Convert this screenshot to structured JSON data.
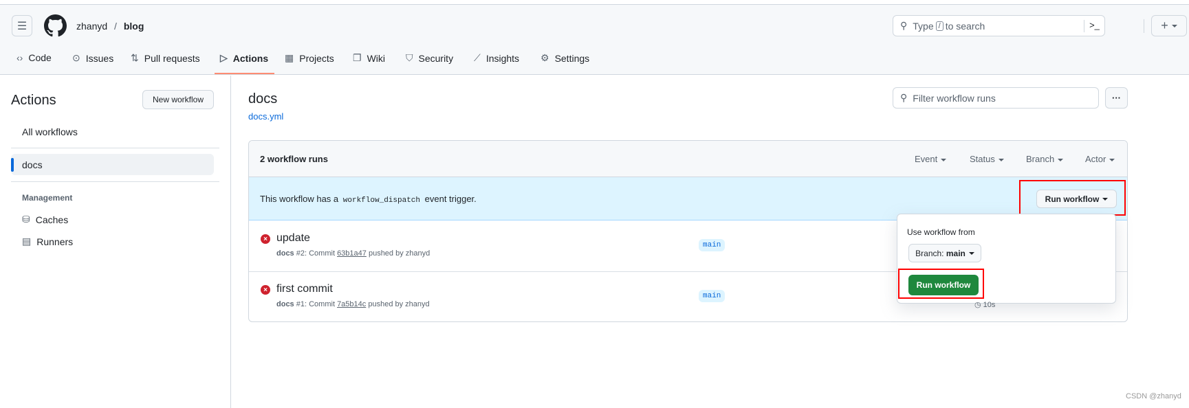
{
  "header": {
    "owner": "zhanyd",
    "separator": "/",
    "repo": "blog",
    "search_prefix": "Type",
    "search_key": "/",
    "search_suffix": "to search"
  },
  "tabs": [
    {
      "label": "Code",
      "icon": "code-icon"
    },
    {
      "label": "Issues",
      "icon": "issue-icon"
    },
    {
      "label": "Pull requests",
      "icon": "pull-request-icon"
    },
    {
      "label": "Actions",
      "icon": "play-icon",
      "active": true
    },
    {
      "label": "Projects",
      "icon": "table-icon"
    },
    {
      "label": "Wiki",
      "icon": "book-icon"
    },
    {
      "label": "Security",
      "icon": "shield-icon"
    },
    {
      "label": "Insights",
      "icon": "graph-icon"
    },
    {
      "label": "Settings",
      "icon": "gear-icon"
    }
  ],
  "sidebar": {
    "title": "Actions",
    "new_workflow": "New workflow",
    "all_workflows": "All workflows",
    "selected": "docs",
    "management": "Management",
    "caches": "Caches",
    "runners": "Runners"
  },
  "main": {
    "title": "docs",
    "file": "docs.yml",
    "filter_placeholder": "Filter workflow runs",
    "run_count": "2 workflow runs",
    "filters": [
      "Event",
      "Status",
      "Branch",
      "Actor"
    ],
    "banner": {
      "prefix": "This workflow has a",
      "code": "workflow_dispatch",
      "suffix": "event trigger.",
      "button": "Run workflow"
    },
    "runs": [
      {
        "title": "update",
        "workflow": "docs",
        "number": "#2",
        "commit_label": ": Commit",
        "sha": "63b1a47",
        "pushed": "pushed by zhanyd",
        "branch": "main",
        "status": "failure"
      },
      {
        "title": "first commit",
        "workflow": "docs",
        "number": "#1",
        "commit_label": ": Commit",
        "sha": "7a5b14c",
        "pushed": "pushed by zhanyd",
        "branch": "main",
        "status": "failure",
        "duration": "10s"
      }
    ],
    "dropdown": {
      "label": "Use workflow from",
      "branch_prefix": "Branch:",
      "branch": "main",
      "run_button": "Run workflow"
    }
  },
  "watermark": "CSDN @zhanyd",
  "colors": {
    "accent_underline": "#fd8c73",
    "primary_green": "#1f883d",
    "highlight_red": "#ff0000",
    "banner_blue": "#ddf4ff",
    "failure_red": "#cf222e"
  }
}
